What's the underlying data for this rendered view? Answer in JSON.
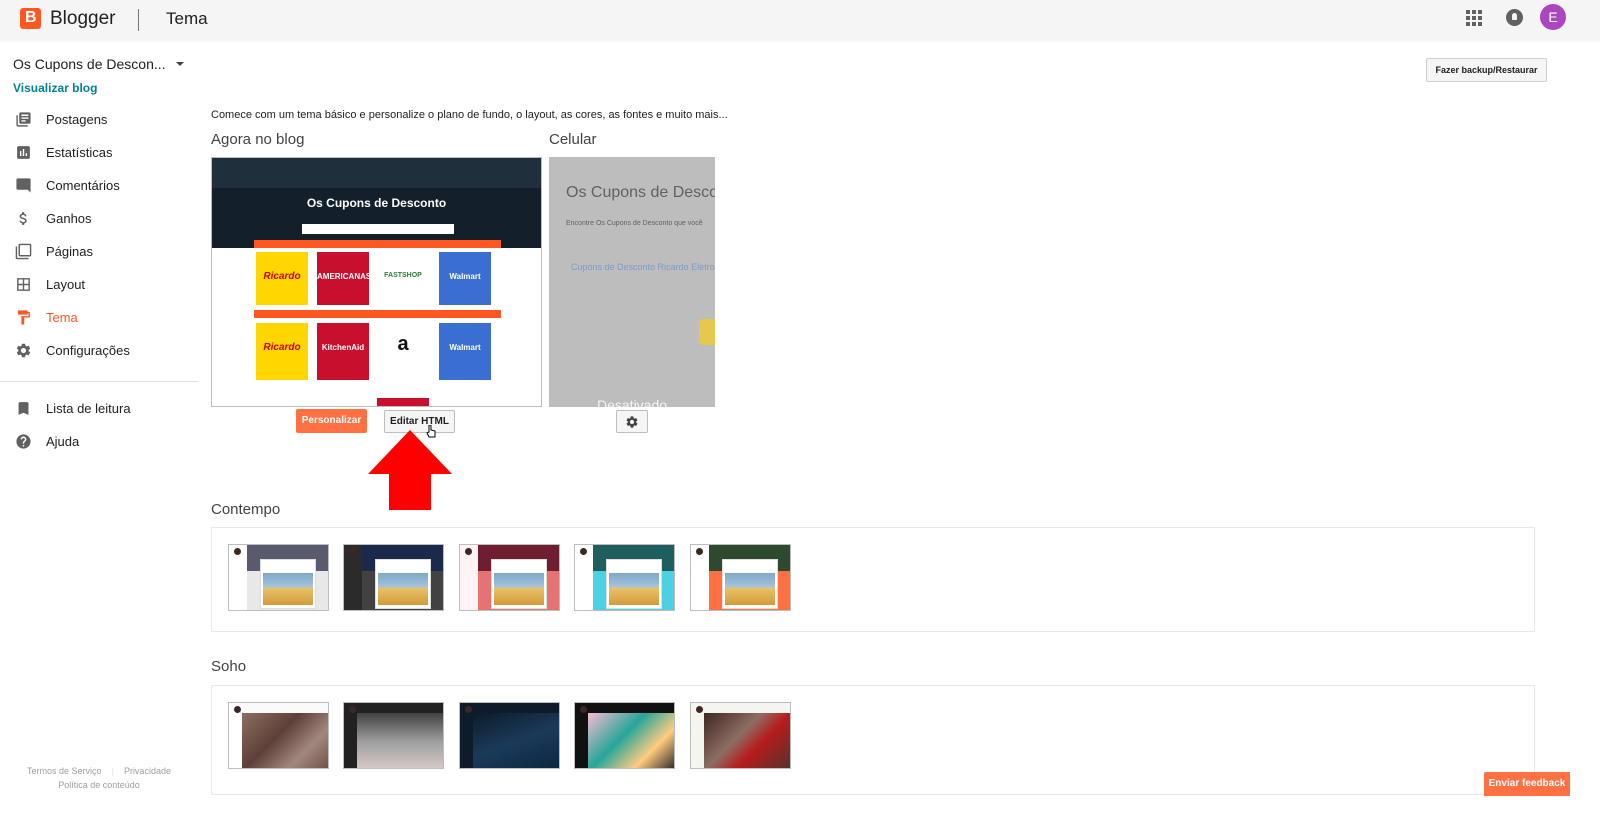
{
  "topbar": {
    "brand": "Blogger",
    "page_title": "Tema",
    "avatar_letter": "E"
  },
  "sidebar": {
    "blog_name": "Os Cupons de Descon...",
    "view_blog": "Visualizar blog",
    "items": [
      {
        "label": "Postagens",
        "icon": "posts-icon"
      },
      {
        "label": "Estatísticas",
        "icon": "stats-icon"
      },
      {
        "label": "Comentários",
        "icon": "comments-icon"
      },
      {
        "label": "Ganhos",
        "icon": "dollar-icon"
      },
      {
        "label": "Páginas",
        "icon": "pages-icon"
      },
      {
        "label": "Layout",
        "icon": "layout-icon"
      },
      {
        "label": "Tema",
        "icon": "theme-roller-icon",
        "active": true
      },
      {
        "label": "Configurações",
        "icon": "gear-icon"
      }
    ],
    "secondary_items": [
      {
        "label": "Lista de leitura",
        "icon": "bookmark-icon"
      },
      {
        "label": "Ajuda",
        "icon": "help-icon"
      }
    ],
    "footer": {
      "terms": "Termos de Serviço",
      "privacy": "Privacidade",
      "content_policy": "Política de conteúdo"
    }
  },
  "main": {
    "backup_button": "Fazer backup/Restaurar",
    "intro": "Comece com um tema básico e personalize o plano de fundo, o layout, as cores, as fontes e muito mais...",
    "current_label": "Agora no blog",
    "mobile_label": "Celular",
    "preview": {
      "blog_title": "Os Cupons de Desconto",
      "tiles_row1": [
        "Ricardo",
        "AMERICANAS",
        "FASTSHOP",
        "Walmart"
      ],
      "tiles_row2": [
        "Ricardo",
        "KitchenAid",
        "a",
        "Walmart"
      ]
    },
    "mobile_preview": {
      "title": "Os Cupons de Desconto",
      "subtitle": "Encontre Os Cupons de Desconto que você",
      "link": "Cupons de Desconto Ricardo Eletro",
      "status": "Desativado"
    },
    "customize_button": "Personalizar",
    "edit_html_button": "Editar HTML",
    "sections": [
      {
        "title": "Contempo"
      },
      {
        "title": "Soho"
      }
    ]
  },
  "feedback_button": "Enviar feedback",
  "colors": {
    "accent": "#ff5722",
    "link": "#00838f",
    "arrow": "#ff0000"
  }
}
